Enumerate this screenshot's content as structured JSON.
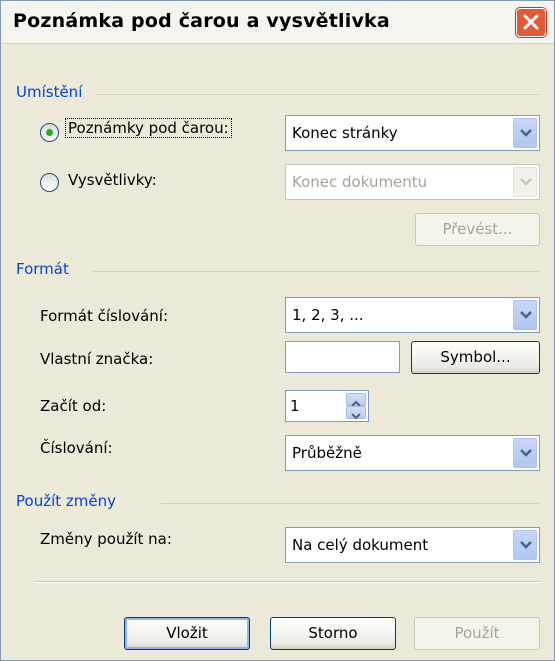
{
  "dialog": {
    "title": "Poznámka pod čarou a vysvětlivka"
  },
  "placement": {
    "group_title": "Umístění",
    "footnotes": {
      "label": "Poznámky pod čarou:",
      "selected": true,
      "value": "Konec stránky"
    },
    "endnotes": {
      "label": "Vysvětlivky:",
      "selected": false,
      "value": "Konec dokumentu"
    },
    "convert_label": "Převést..."
  },
  "format": {
    "group_title": "Formát",
    "number_format": {
      "label": "Formát číslování:",
      "value": "1, 2, 3, ..."
    },
    "custom_mark": {
      "label": "Vlastní značka:",
      "value": "",
      "symbol_label": "Symbol..."
    },
    "start_at": {
      "label": "Začít od:",
      "value": "1"
    },
    "numbering": {
      "label": "Číslování:",
      "value": "Průběžně"
    }
  },
  "apply": {
    "group_title": "Použít změny",
    "apply_to": {
      "label": "Změny použít na:",
      "value": "Na celý dokument"
    }
  },
  "buttons": {
    "insert": "Vložit",
    "cancel": "Storno",
    "apply": "Použít"
  },
  "colors": {
    "group_title": "#0046d5",
    "close_button": "#e35a3a",
    "radio_dot": "#2fa92b"
  }
}
